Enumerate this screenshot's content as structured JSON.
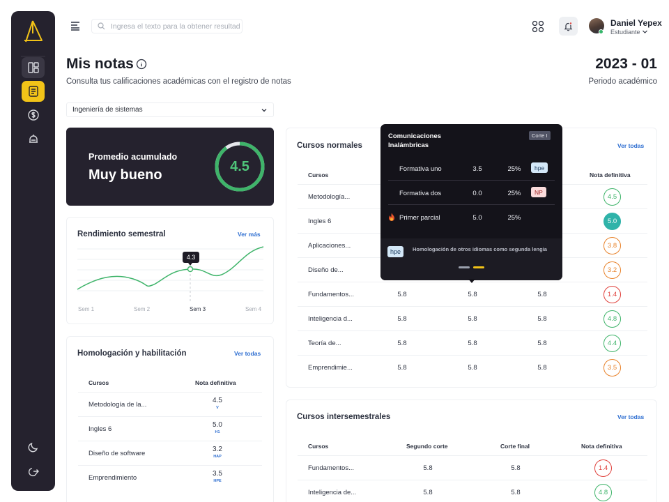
{
  "sidebar": {
    "items": [
      {
        "icon": "dashboard-icon"
      },
      {
        "icon": "notes-icon"
      },
      {
        "icon": "dollar-icon"
      },
      {
        "icon": "graduation-cap-icon"
      }
    ],
    "bottom": [
      {
        "icon": "moon-icon"
      },
      {
        "icon": "logout-icon"
      }
    ]
  },
  "header": {
    "search_placeholder": "Ingresa el texto para la obtener resultados",
    "user_name": "Daniel Yepex",
    "user_role": "Estudiante"
  },
  "page": {
    "title": "Mis notas",
    "subtitle": "Consulta tus calificaciones académicas con el registro de notas",
    "period": "2023 - 01",
    "period_label": "Periodo académico",
    "career": "Ingeniería de sistemas"
  },
  "average": {
    "label": "Promedio acumulado",
    "rating": "Muy bueno",
    "value": "4.5",
    "fraction": 0.9
  },
  "performance": {
    "title": "Rendimiento semestral",
    "link": "Ver más",
    "ticks": [
      "Sem 1",
      "Sem 2",
      "Sem 3",
      "Sem 4"
    ],
    "tooltip": "4.3"
  },
  "homologation": {
    "title": "Homologación y habilitación",
    "link": "Ver todas",
    "col_course": "Cursos",
    "col_grade": "Nota definitiva",
    "rows": [
      {
        "name": "Metodología de la...",
        "grade": "4.5",
        "code": "V"
      },
      {
        "name": "Ingles 6",
        "grade": "5.0",
        "code": "H1"
      },
      {
        "name": "Diseño de software",
        "grade": "3.2",
        "code": "HAP"
      },
      {
        "name": "Emprendimiento",
        "grade": "3.5",
        "code": "HPE"
      }
    ]
  },
  "normal_courses": {
    "title": "Cursos normales",
    "link": "Ver todas",
    "col_course": "Cursos",
    "col_final": "Nota definitiva",
    "rows": [
      {
        "name": "Metodología...",
        "a": "",
        "b": "",
        "c": "",
        "grade": "4.5",
        "tone": "green"
      },
      {
        "name": "Ingles 6",
        "a": "",
        "b": "",
        "c": "",
        "grade": "5.0",
        "tone": "teal"
      },
      {
        "name": "Aplicaciones...",
        "a": "",
        "b": "",
        "c": "",
        "grade": "3.8",
        "tone": "orange"
      },
      {
        "name": "Diseño de...",
        "a": "",
        "b": "",
        "c": "",
        "grade": "3.2",
        "tone": "orange"
      },
      {
        "name": "Fundamentos...",
        "a": "5.8",
        "b": "5.8",
        "c": "5.8",
        "grade": "1.4",
        "tone": "red"
      },
      {
        "name": "Inteligencia d...",
        "a": "5.8",
        "b": "5.8",
        "c": "5.8",
        "grade": "4.8",
        "tone": "green"
      },
      {
        "name": "Teoría de...",
        "a": "5.8",
        "b": "5.8",
        "c": "5.8",
        "grade": "4.4",
        "tone": "green"
      },
      {
        "name": "Emprendimie...",
        "a": "5.8",
        "b": "5.8",
        "c": "5.8",
        "grade": "3.5",
        "tone": "orange"
      }
    ]
  },
  "inter_courses": {
    "title": "Cursos intersemestrales",
    "link": "Ver todas",
    "col_course": "Cursos",
    "col_second": "Segundo corte",
    "col_final_cut": "Corte final",
    "col_final": "Nota definitiva",
    "rows": [
      {
        "name": "Fundamentos...",
        "a": "5.8",
        "b": "5.8",
        "grade": "1.4",
        "tone": "red"
      },
      {
        "name": "Inteligencia de...",
        "a": "5.8",
        "b": "5.8",
        "grade": "4.8",
        "tone": "green"
      }
    ]
  },
  "popup": {
    "title": "Comunicaciones Inalámbricas",
    "tag": "Corte I",
    "rows": [
      {
        "name": "Formativa uno",
        "grade": "3.5",
        "weight": "25%",
        "badge": "hpe",
        "badge_type": "hpe"
      },
      {
        "name": "Formativa dos",
        "grade": "0.0",
        "weight": "25%",
        "badge": "NP",
        "badge_type": "np"
      },
      {
        "name": "Primer parcial",
        "grade": "5.0",
        "weight": "25%",
        "badge": "",
        "badge_type": ""
      }
    ],
    "footer_badge": "hpe",
    "footer_text": "Homologación de otros idiomas como segunda lengia"
  },
  "colors": {
    "accent_yellow": "#f2c318",
    "dark": "#25222e",
    "green": "#3fb46a",
    "teal": "#2fb3a9",
    "orange": "#e8822a",
    "red": "#e0413c",
    "link": "#2f6fd1"
  }
}
